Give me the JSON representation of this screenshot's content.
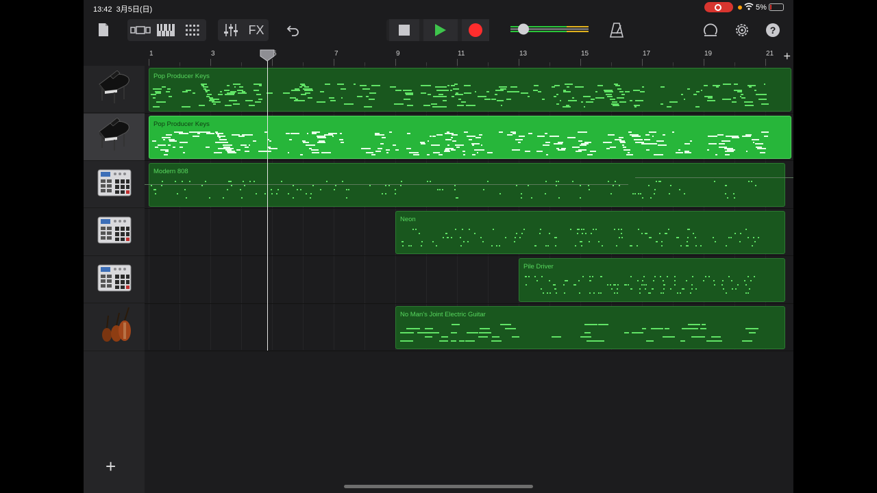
{
  "status": {
    "time": "13:42",
    "date": "3月5日(日)",
    "battery": "5%"
  },
  "toolbar": {
    "fx_label": "FX",
    "icons": [
      "document-icon",
      "view-toggle-icon",
      "keyboard-icon",
      "grid-icon",
      "mixer-icon",
      "undo-icon",
      "stop-icon",
      "play-icon",
      "record-icon",
      "volume-slider",
      "metronome-icon",
      "loop-icon",
      "settings-icon",
      "help-icon"
    ],
    "volume_level": 0.18
  },
  "ruler": {
    "bars": [
      "1",
      "3",
      "5",
      "7",
      "9",
      "11",
      "13",
      "15",
      "17",
      "19",
      "21"
    ]
  },
  "colors": {
    "region": "#19571e",
    "region_active": "#27b63a",
    "note": "#61e466",
    "background": "#1c1c1e"
  },
  "tracks": [
    {
      "instrument": "grand-piano-icon",
      "selected": false
    },
    {
      "instrument": "grand-piano-icon",
      "selected": true
    },
    {
      "instrument": "drum-machine-icon",
      "selected": false
    },
    {
      "instrument": "drum-machine-icon",
      "selected": false
    },
    {
      "instrument": "drum-machine-icon",
      "selected": false
    },
    {
      "instrument": "string-instruments-icon",
      "selected": false
    }
  ],
  "regions": [
    {
      "name": "Pop Producer Keys",
      "track": 0,
      "start_bar": 1.0,
      "end_bar": 21.8
    },
    {
      "name": "Pop Producer Keys",
      "track": 1,
      "start_bar": 1.0,
      "end_bar": 21.8,
      "active": true
    },
    {
      "name": "Modern 808",
      "track": 2,
      "start_bar": 1.0,
      "end_bar": 21.6
    },
    {
      "name": "Neon",
      "track": 3,
      "start_bar": 9.0,
      "end_bar": 21.6
    },
    {
      "name": "Pile Driver",
      "track": 4,
      "start_bar": 13.0,
      "end_bar": 21.6
    },
    {
      "name": "No Man's Joint Electric Guitar",
      "track": 5,
      "start_bar": 9.0,
      "end_bar": 21.6
    }
  ],
  "playhead_bar": 4.85
}
